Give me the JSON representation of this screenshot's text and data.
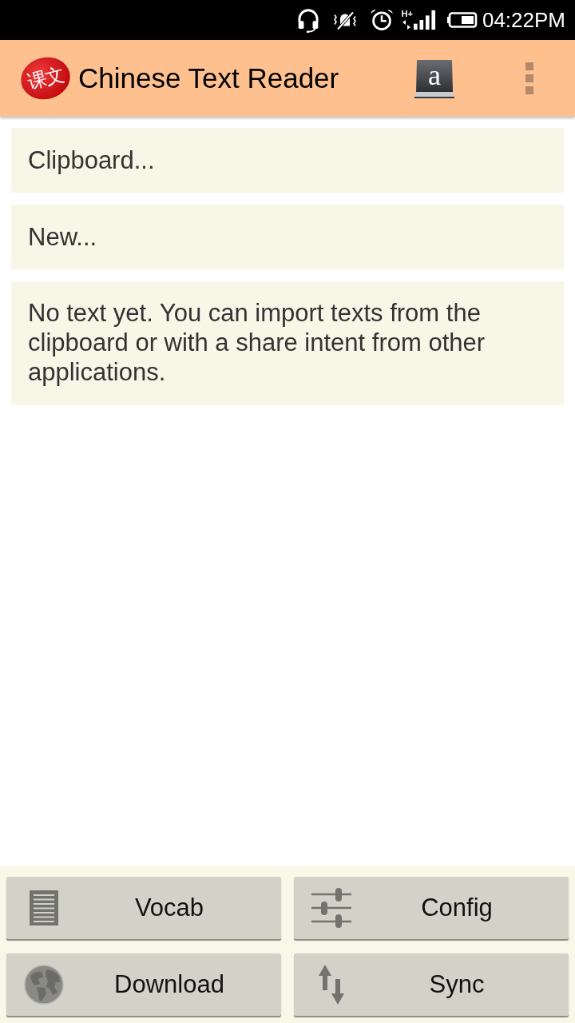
{
  "status_bar": {
    "network": "H+",
    "time": "04:22PM"
  },
  "app_bar": {
    "logo_text": "课文",
    "title": "Chinese Text Reader",
    "dictionary_letter": "a"
  },
  "entries": [
    {
      "label": "Clipboard..."
    },
    {
      "label": "New..."
    }
  ],
  "empty_message": "No text yet. You can import texts from the clipboard or with a share intent from other applications.",
  "buttons": [
    {
      "label": "Vocab"
    },
    {
      "label": "Config"
    },
    {
      "label": "Download"
    },
    {
      "label": "Sync"
    }
  ]
}
